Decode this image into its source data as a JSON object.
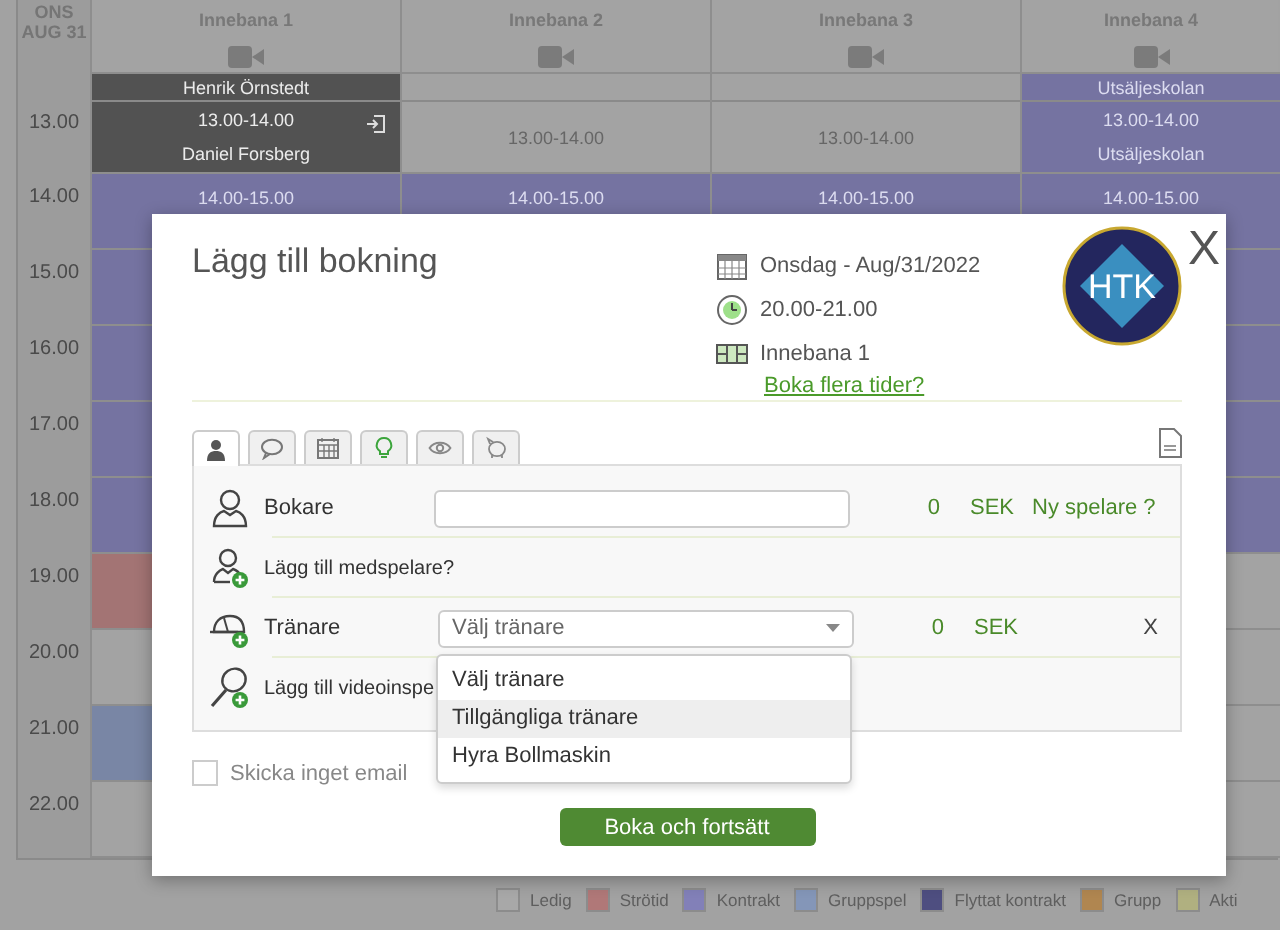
{
  "calendar": {
    "date_header": [
      "ONS",
      "AUG 31"
    ],
    "courts": [
      "Innebana 1",
      "Innebana 2",
      "Innebana 3",
      "Innebana 4"
    ],
    "rows": [
      {
        "time": "13.00",
        "cells": [
          {
            "color": "#525252",
            "top": "Henrik Örnstedt",
            "time": "13.00-14.00",
            "bottom": "Daniel Forsberg"
          },
          {
            "color": "#a3a3a3",
            "time": "13.00-14.00"
          },
          {
            "color": "#a3a3a3",
            "time": "13.00-14.00"
          },
          {
            "color": "#7573a1",
            "top": "Utsäljeskolan",
            "time": "13.00-14.00",
            "bottom": "Utsäljeskolan"
          }
        ]
      },
      {
        "time": "14.00",
        "cells": [
          {
            "color": "#7573a1",
            "time": "14.00-15.00"
          },
          {
            "color": "#7573a1",
            "time": "14.00-15.00"
          },
          {
            "color": "#7573a1",
            "time": "14.00-15.00"
          },
          {
            "color": "#7573a1",
            "time": "14.00-15.00"
          }
        ]
      },
      {
        "time": "15.00",
        "cells": [
          {
            "color": "#7573a1"
          },
          null,
          null,
          {
            "color": "#7573a1"
          }
        ]
      },
      {
        "time": "16.00",
        "cells": [
          {
            "color": "#7573a1"
          },
          null,
          null,
          {
            "color": "#7573a1"
          }
        ]
      },
      {
        "time": "17.00",
        "cells": [
          {
            "color": "#7573a1"
          },
          null,
          null,
          {
            "color": "#7573a1"
          }
        ]
      },
      {
        "time": "18.00",
        "cells": [
          {
            "color": "#7573a1"
          },
          null,
          null,
          {
            "color": "#7573a1"
          }
        ]
      },
      {
        "time": "19.00",
        "cells": [
          {
            "color": "#a37474"
          },
          null,
          null,
          {
            "color": "#a3a3a3"
          }
        ]
      },
      {
        "time": "20.00",
        "cells": [
          {
            "color": "#a3a3a3"
          },
          null,
          null,
          {
            "color": "#a3a3a3"
          }
        ]
      },
      {
        "time": "21.00",
        "cells": [
          {
            "color": "#7986a5"
          },
          null,
          null,
          {
            "color": "#a3a3a3"
          }
        ]
      },
      {
        "time": "22.00",
        "cells": [
          {
            "color": "#a3a3a3"
          },
          null,
          null,
          {
            "color": "#a3a3a3"
          }
        ]
      }
    ]
  },
  "legend": [
    {
      "label": "Ledig",
      "color": "#a8a8a8"
    },
    {
      "label": "Strötid",
      "color": "#b07878"
    },
    {
      "label": "Kontrakt",
      "color": "#8280b8"
    },
    {
      "label": "Gruppspel",
      "color": "#8496b8"
    },
    {
      "label": "Flyttat kontrakt",
      "color": "#4e4e80"
    },
    {
      "label": "Grupp",
      "color": "#b08650"
    },
    {
      "label": "Akti",
      "color": "#b0b080"
    }
  ],
  "dialog": {
    "title": "Lägg till bokning",
    "date": "Onsdag - Aug/31/2022",
    "time": "20.00-21.00",
    "court": "Innebana 1",
    "more_link": "Boka flera tider?",
    "logo": {
      "text": "HTK"
    },
    "close": "X",
    "tabs": [
      {
        "kind": "person",
        "selected": true
      },
      {
        "kind": "comment",
        "selected": false
      },
      {
        "kind": "calendar",
        "selected": false
      },
      {
        "kind": "lightbulb",
        "selected": false
      },
      {
        "kind": "eye",
        "selected": false
      },
      {
        "kind": "piggy",
        "selected": false
      }
    ],
    "rows": [
      {
        "kind": "booker",
        "label": "Bokare",
        "price": "0",
        "currency": "SEK",
        "link": "Ny spelare ?"
      },
      {
        "kind": "add_player",
        "label": "Lägg till medspelare?"
      },
      {
        "kind": "trainer",
        "label": "Tränare",
        "value": "Välj tränare",
        "price": "0",
        "currency": "SEK",
        "remove": "X",
        "options": [
          {
            "label": "Välj tränare",
            "highlighted": false
          },
          {
            "label": "Tillgängliga tränare",
            "highlighted": true
          },
          {
            "label": "Hyra Bollmaskin",
            "highlighted": false
          }
        ]
      },
      {
        "kind": "add_video",
        "label": "Lägg till videoinspe"
      }
    ],
    "no_email": {
      "label": "Skicka inget email",
      "checked": false
    },
    "submit": "Boka och fortsätt"
  }
}
